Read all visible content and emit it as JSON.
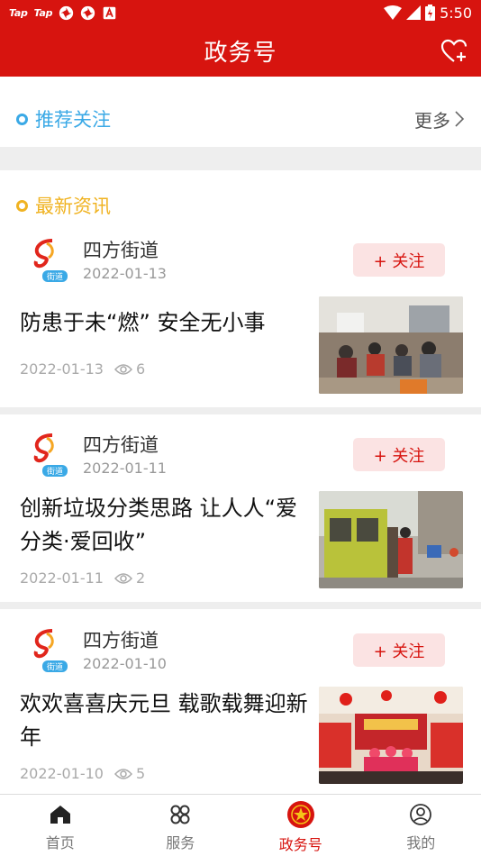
{
  "status_bar": {
    "left_labels": [
      "Tap",
      "Tap"
    ],
    "time": "5:50"
  },
  "app_bar": {
    "title": "政务号",
    "right_icon": "heart-plus-icon"
  },
  "recommend": {
    "title": "推荐关注",
    "more_label": "更多"
  },
  "latest": {
    "title": "最新资讯"
  },
  "articles": [
    {
      "source": "四方街道",
      "source_badge": "街道",
      "source_date": "2022-01-13",
      "follow_label": "+ 关注",
      "headline": "防患于未“燃” 安全无小事",
      "date": "2022-01-13",
      "views": "6"
    },
    {
      "source": "四方街道",
      "source_badge": "街道",
      "source_date": "2022-01-11",
      "follow_label": "+ 关注",
      "headline": "创新垃圾分类思路 让人人“爱分类·爱回收”",
      "date": "2022-01-11",
      "views": "2"
    },
    {
      "source": "四方街道",
      "source_badge": "街道",
      "source_date": "2022-01-10",
      "follow_label": "+ 关注",
      "headline": "欢欢喜喜庆元旦 载歌载舞迎新年",
      "date": "2022-01-10",
      "views": "5"
    }
  ],
  "tabs": [
    {
      "label": "首页",
      "icon": "home-icon"
    },
    {
      "label": "服务",
      "icon": "grid-icon"
    },
    {
      "label": "政务号",
      "icon": "emblem-icon"
    },
    {
      "label": "我的",
      "icon": "user-icon"
    }
  ],
  "colors": {
    "brand_red": "#d7140f",
    "recommend_blue": "#3aa9e6",
    "latest_yellow": "#f0b322"
  }
}
